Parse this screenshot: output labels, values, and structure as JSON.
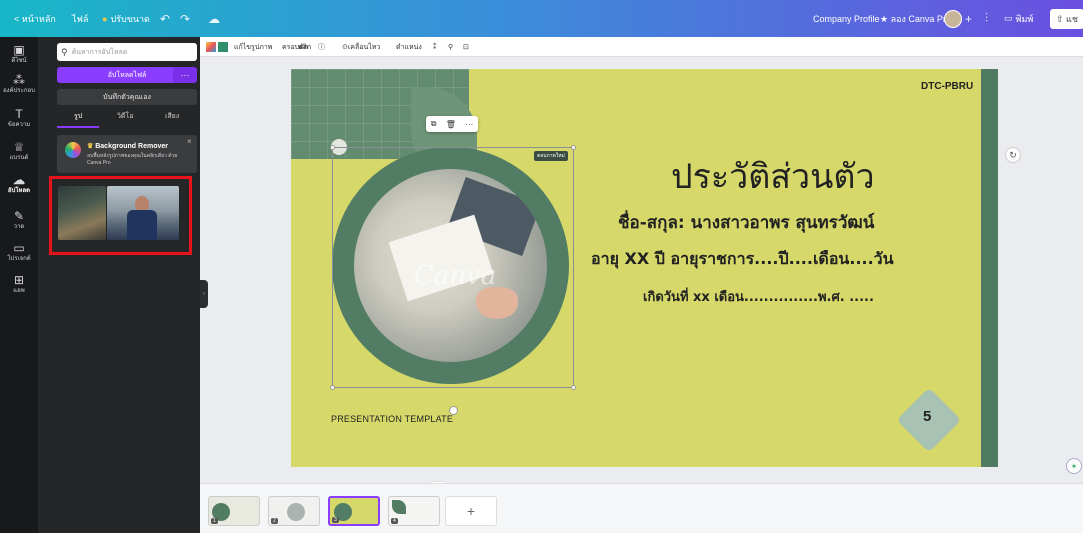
{
  "topbar": {
    "home_label": "< หน้าหลัก",
    "file_label": "ไฟล์",
    "resize_label": "ปรับขนาด",
    "doc_title": "Company Profile",
    "pro_label": "★ ลอง Canva Pro",
    "print_label": "พิมพ์",
    "share_label": "แช"
  },
  "rail": [
    {
      "icon": "template-icon",
      "label": "ดีไซน์"
    },
    {
      "icon": "elements-icon",
      "label": "องค์ประกอบ"
    },
    {
      "icon": "text-icon",
      "label": "ข้อความ"
    },
    {
      "icon": "brand-icon",
      "label": "แบรนด์"
    },
    {
      "icon": "upload-icon",
      "label": "อัปโหลด"
    },
    {
      "icon": "draw-icon",
      "label": "วาด"
    },
    {
      "icon": "projects-icon",
      "label": "โปรเจกต์"
    },
    {
      "icon": "apps-icon",
      "label": "แอพ"
    }
  ],
  "panel": {
    "search_placeholder": "ค้นหาการอัปโหลด",
    "upload_label": "อัปโหลดไฟล์",
    "more_label": "···",
    "record_label": "บันทึกตัวคุณเอง",
    "tabs": [
      "รูป",
      "วิดีโอ",
      "เสียง"
    ],
    "bg_remover": {
      "title": "Background Remover",
      "desc": "ลบพื้นหลังรูปภาพของคุณในคลิกเดียว ด้วย Canva Pro"
    }
  },
  "toolbar": {
    "edit_image": "แก้ไขรูปภาพ",
    "crop": "ครอบตัด",
    "flip": "พลิก",
    "animate": "เคลื่อนไหว",
    "position": "ตำแหน่ง"
  },
  "slide": {
    "tag": "DTC-PBRU",
    "title": "ประวัติส่วนตัว",
    "line1": "ชื่อ-สกุล: นางสาวอาพร สุนทรวัฒน์",
    "line2": "อายุ  XX  ปี อายุราชการ....ปี....เดือน....วัน",
    "line3": "เกิดวันที่ xx เดือน...............พ.ศ. .....",
    "presentation": "PRESENTATION TEMPLATE",
    "page_number": "5",
    "photo_watermark": "Canva",
    "photo_label": "ตอบภาพใหม่"
  },
  "pages": [
    "1",
    "2",
    "3",
    "4"
  ],
  "add_page": "+",
  "colors": {
    "slide_bg": "#d6d96a",
    "accent_green": "#527d64",
    "brand_purple": "#8b3dff",
    "highlight_red": "#e8141b"
  }
}
